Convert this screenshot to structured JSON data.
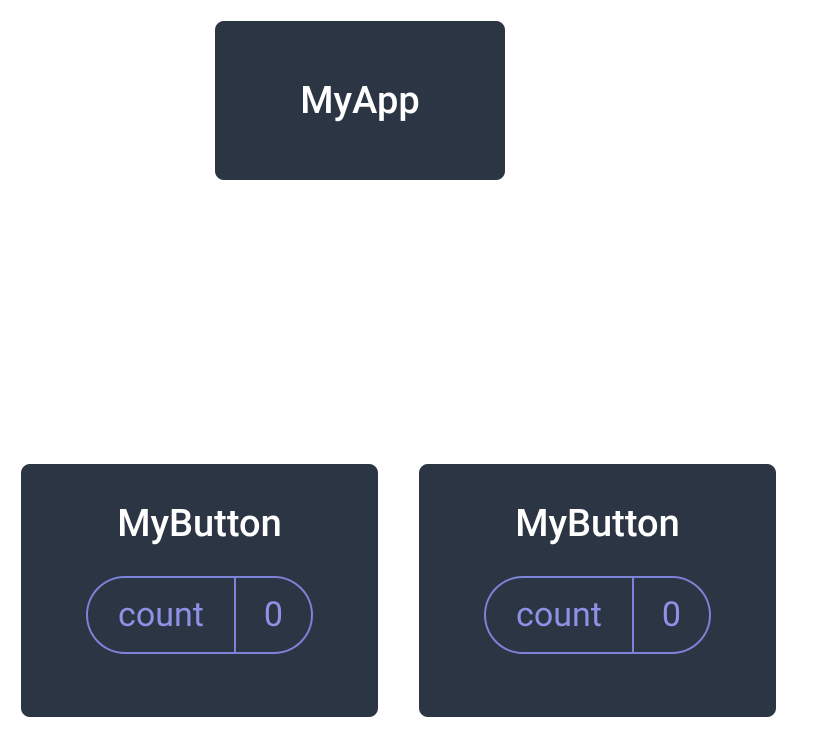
{
  "diagram": {
    "root": {
      "label": "MyApp"
    },
    "children": [
      {
        "label": "MyButton",
        "prop": {
          "name": "count",
          "value": "0"
        }
      },
      {
        "label": "MyButton",
        "prop": {
          "name": "count",
          "value": "0"
        }
      }
    ]
  }
}
